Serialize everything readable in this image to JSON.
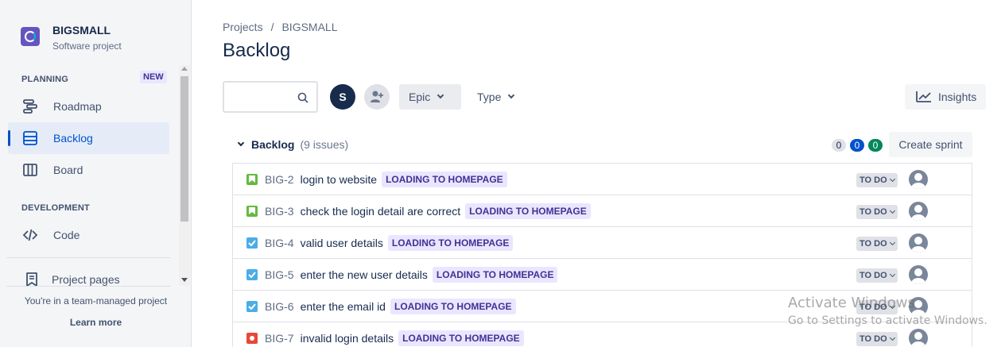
{
  "project": {
    "name": "BIGSMALL",
    "type": "Software project"
  },
  "sidebar": {
    "planning_label": "PLANNING",
    "new_badge": "NEW",
    "items": [
      {
        "label": "Roadmap",
        "icon": "roadmap-icon"
      },
      {
        "label": "Backlog",
        "icon": "backlog-icon",
        "active": true
      },
      {
        "label": "Board",
        "icon": "board-icon"
      }
    ],
    "development_label": "DEVELOPMENT",
    "code_label": "Code",
    "project_pages_label": "Project pages",
    "footer_text": "You're in a team-managed project",
    "learn_more": "Learn more"
  },
  "breadcrumb": {
    "root": "Projects",
    "sep": "/",
    "current": "BIGSMALL"
  },
  "page_title": "Backlog",
  "toolbar": {
    "search_placeholder": "",
    "avatar_initial": "S",
    "epic_label": "Epic",
    "type_label": "Type",
    "insights_label": "Insights"
  },
  "backlog": {
    "title": "Backlog",
    "count_label": "(9 issues)",
    "counts": {
      "todo": "0",
      "in_progress": "0",
      "done": "0"
    },
    "create_sprint_label": "Create sprint",
    "issues": [
      {
        "key": "BIG-2",
        "summary": "login to website",
        "type": "story",
        "epic": "LOADING TO HOMEPAGE",
        "status": "TO DO"
      },
      {
        "key": "BIG-3",
        "summary": "check the login detail are correct",
        "type": "story",
        "epic": "LOADING TO HOMEPAGE",
        "status": "TO DO"
      },
      {
        "key": "BIG-4",
        "summary": "valid user details",
        "type": "task",
        "epic": "LOADING TO HOMEPAGE",
        "status": "TO DO"
      },
      {
        "key": "BIG-5",
        "summary": "enter the new user details",
        "type": "task",
        "epic": "LOADING TO HOMEPAGE",
        "status": "TO DO"
      },
      {
        "key": "BIG-6",
        "summary": "enter the email id",
        "type": "task",
        "epic": "LOADING TO HOMEPAGE",
        "status": "TO DO"
      },
      {
        "key": "BIG-7",
        "summary": "invalid login details",
        "type": "bug",
        "epic": "LOADING TO HOMEPAGE",
        "status": "TO DO"
      }
    ]
  },
  "watermark": {
    "line1": "Activate Windows",
    "line2": "Go to Settings to activate Windows."
  },
  "colors": {
    "accent": "#0052cc",
    "epic_bg": "#eae6ff",
    "epic_text": "#403294",
    "story": "#63ba3c",
    "task": "#4bade8",
    "bug": "#e5493a"
  }
}
